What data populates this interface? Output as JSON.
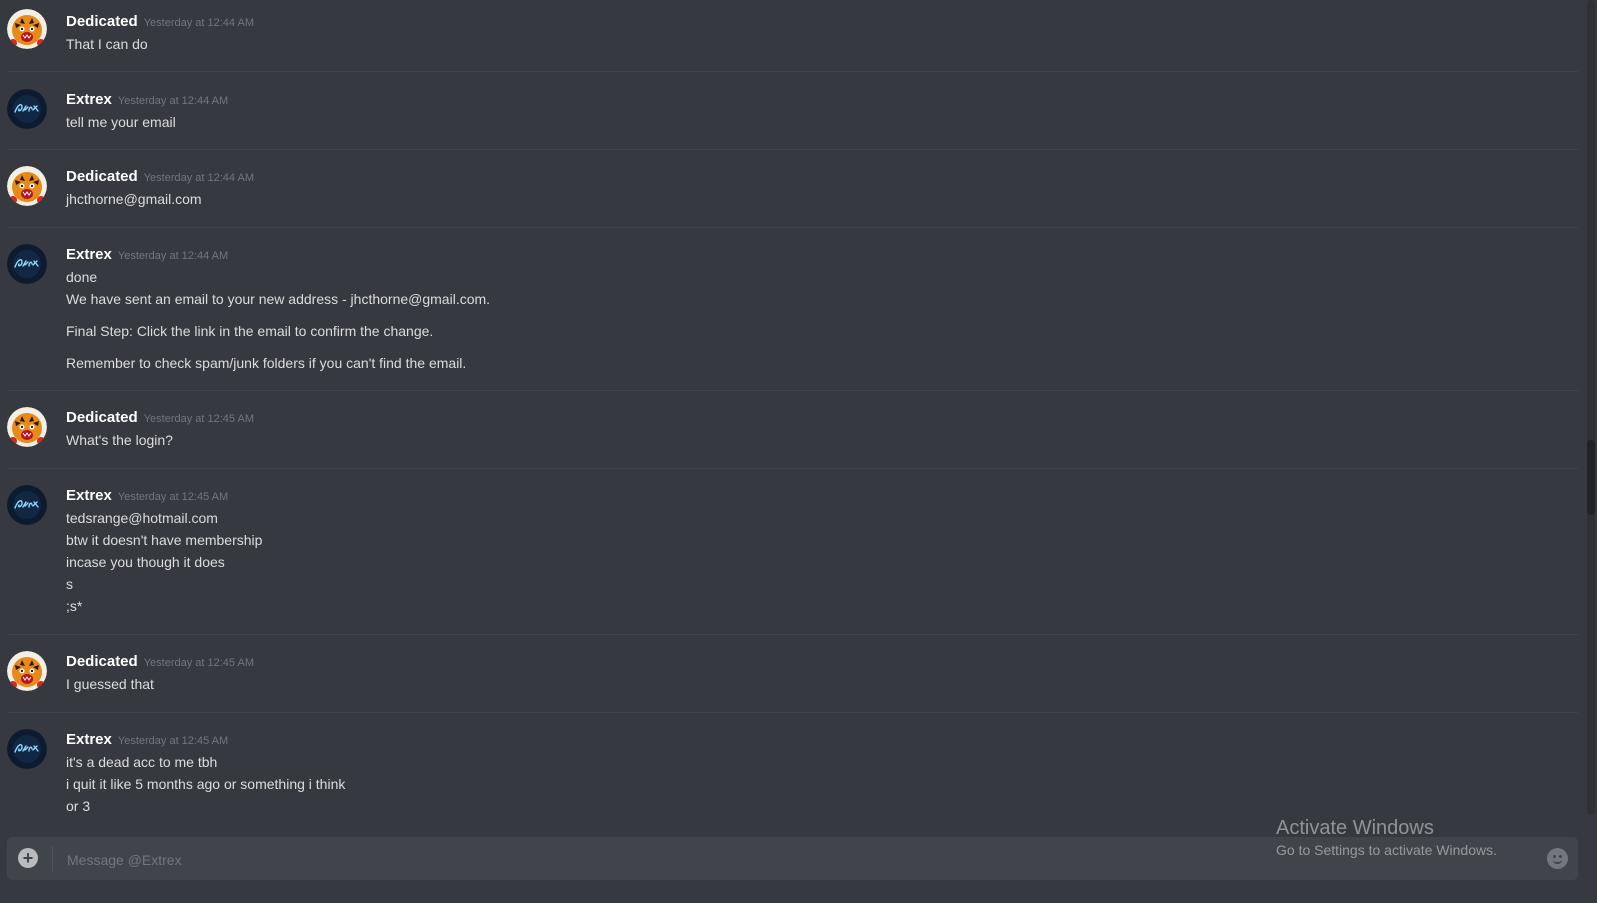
{
  "messages": [
    {
      "author": "Dedicated",
      "timestamp": "Yesterday at 12:44 AM",
      "avatar": "tiger",
      "lines": [
        "That I can do"
      ]
    },
    {
      "author": "Extrex",
      "timestamp": "Yesterday at 12:44 AM",
      "avatar": "neon",
      "lines": [
        "tell me your email"
      ]
    },
    {
      "author": "Dedicated",
      "timestamp": "Yesterday at 12:44 AM",
      "avatar": "tiger",
      "lines": [
        "jhcthorne@gmail.com"
      ]
    },
    {
      "author": "Extrex",
      "timestamp": "Yesterday at 12:44 AM",
      "avatar": "neon",
      "lines": [
        "done",
        "We have sent an email to your new address - jhcthorne@gmail.com.",
        "Final Step: Click the link in the email to confirm the change.",
        "Remember to check spam/junk folders if you can't find the email."
      ]
    },
    {
      "author": "Dedicated",
      "timestamp": "Yesterday at 12:45 AM",
      "avatar": "tiger",
      "lines": [
        "What's the login?"
      ]
    },
    {
      "author": "Extrex",
      "timestamp": "Yesterday at 12:45 AM",
      "avatar": "neon",
      "lines": [
        "tedsrange@hotmail.com",
        "btw it doesn't have membership",
        "incase you though it does",
        "s",
        ";s*"
      ]
    },
    {
      "author": "Dedicated",
      "timestamp": "Yesterday at 12:45 AM",
      "avatar": "tiger",
      "lines": [
        "I guessed that"
      ]
    },
    {
      "author": "Extrex",
      "timestamp": "Yesterday at 12:45 AM",
      "avatar": "neon",
      "lines": [
        "it's a dead acc to me tbh",
        "i quit it like 5 months ago or something i think",
        "or 3"
      ]
    }
  ],
  "composer": {
    "placeholder": "Message @Extrex",
    "upload_icon": "plus-circle-icon",
    "emoji_icon": "smiley-icon"
  },
  "watermark": {
    "title": "Activate Windows",
    "subtitle": "Go to Settings to activate Windows."
  },
  "colors": {
    "background": "#36393f",
    "username": "#ffffff",
    "text": "#dcddde",
    "timestamp": "#72767d",
    "composer": "#40444b"
  }
}
